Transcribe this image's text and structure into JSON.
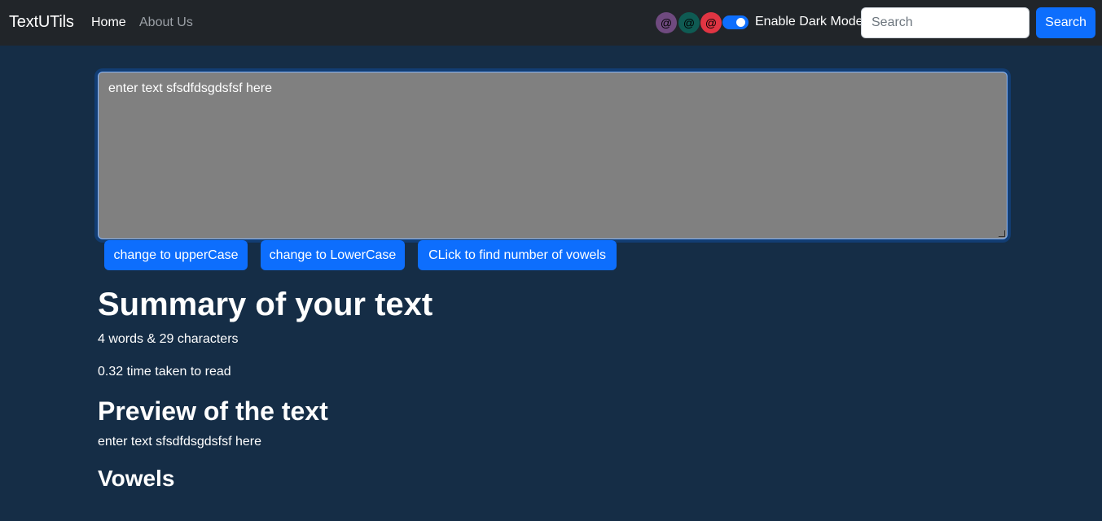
{
  "navbar": {
    "brand": "TextUTils",
    "links": [
      {
        "label": "Home",
        "active": true
      },
      {
        "label": "About Us",
        "active": false
      }
    ],
    "color_swatches": [
      {
        "symbol": "@",
        "color": "#6f4a7f"
      },
      {
        "symbol": "@",
        "color": "#0f5b53"
      },
      {
        "symbol": "@",
        "color": "#e03543"
      }
    ],
    "dark_mode_label": "Enable Dark Mode",
    "dark_mode_on": true,
    "search_placeholder": "Search",
    "search_button": "Search"
  },
  "editor": {
    "value": "enter text sfsdfdsgdsfsf here"
  },
  "actions": {
    "upper": "change to upperCase",
    "lower": "change to LowerCase",
    "vowels": "CLick to find number of vowels"
  },
  "summary": {
    "heading": "Summary of your text",
    "stats": "4 words & 29 characters",
    "read_time": "0.32 time taken to read"
  },
  "preview": {
    "heading": "Preview of the text",
    "text": "enter text sfsdfdsgdsfsf here"
  },
  "vowels": {
    "heading": "Vowels"
  },
  "colors": {
    "page_bg": "#152d46",
    "navbar_bg": "#212529",
    "accent": "#0d6efd",
    "textarea_bg": "#808080"
  }
}
